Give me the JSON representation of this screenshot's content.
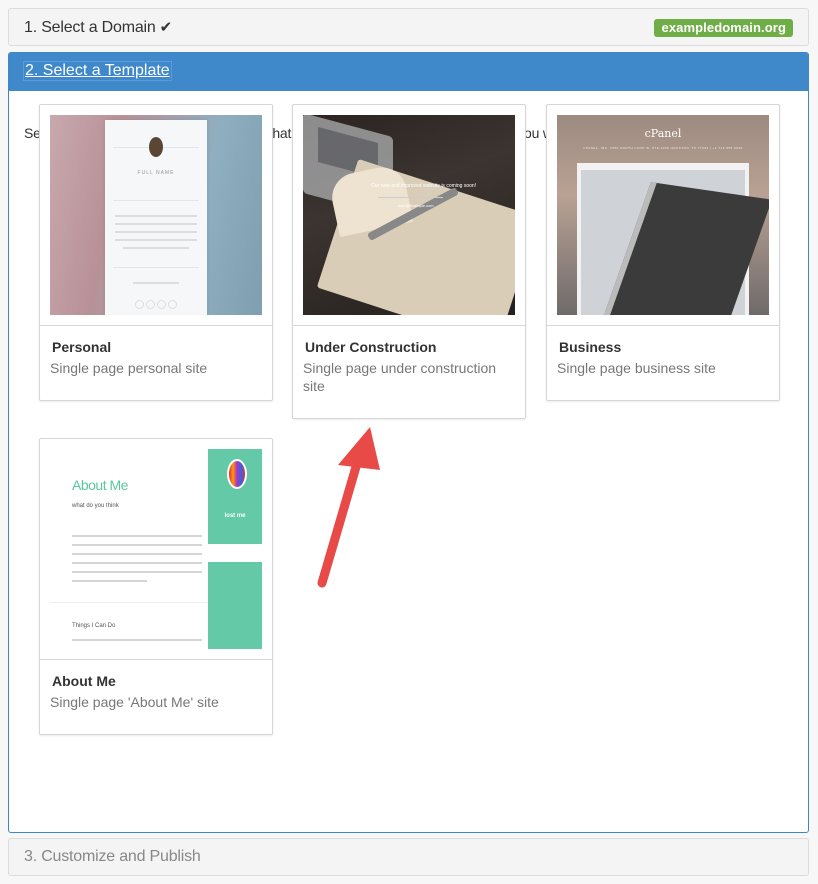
{
  "steps": {
    "step1": {
      "label": "1. Select a Domain",
      "check_icon": "checkmark-icon",
      "domain_badge": "exampledomain.org"
    },
    "step2": {
      "label": "2. Select a Template",
      "intro": "Select a website template. The template that you select determines which content you will enter in the next step."
    },
    "step3": {
      "label": "3. Customize and Publish"
    }
  },
  "templates": [
    {
      "name": "Personal",
      "description": "Single page personal site",
      "preview": {
        "full_name": "FULL NAME"
      }
    },
    {
      "name": "Under Construction",
      "description": "Single page under construction site"
    },
    {
      "name": "Business",
      "description": "Single page business site",
      "preview": {
        "logo": "cPanel",
        "address": "CPANEL, INC. 2550 NORTH LOOP W, STE 4006 HOUSTON, TX 77092 | +1 713 555.0000"
      }
    },
    {
      "name": "About Me",
      "description": "Single page 'About Me' site",
      "preview": {
        "heading": "About Me",
        "subheading": "what do you think",
        "section": "Things I Can Do",
        "side_title": "lost me"
      }
    }
  ],
  "colors": {
    "accent": "#3f89ca",
    "badge": "#6fad47",
    "annotation_arrow": "#e84a47",
    "about_green": "#63c9a6"
  }
}
